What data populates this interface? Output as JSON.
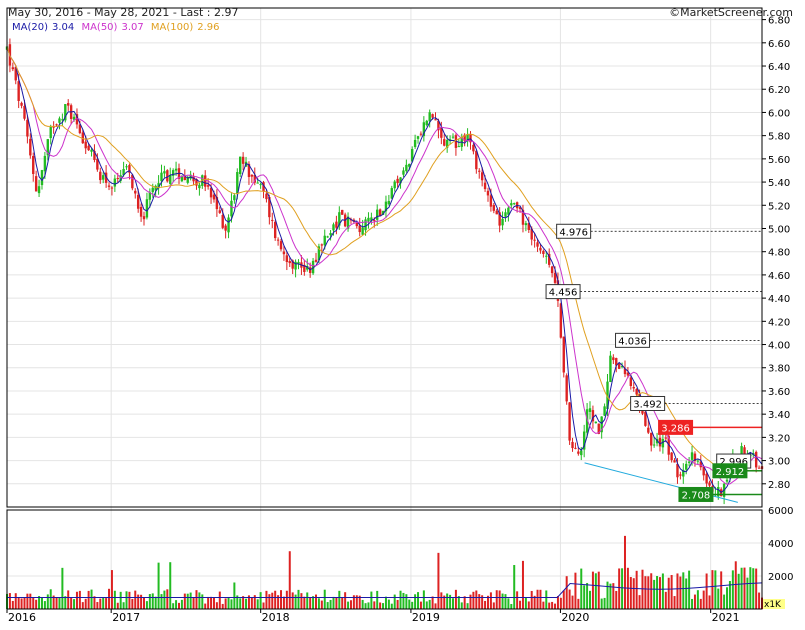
{
  "header": {
    "range_text": "May 30, 2016 - May 28, 2021 - Last : 2.97",
    "brand": "©MarketScreener.com"
  },
  "legend": [
    {
      "label": "MA(20)",
      "value": "3.04",
      "color": "#1a1aa6"
    },
    {
      "label": "MA(50)",
      "value": "3.07",
      "color": "#cc33cc"
    },
    {
      "label": "MA(100)",
      "value": "2.96",
      "color": "#e0a020"
    }
  ],
  "colors": {
    "up": "#22bb22",
    "down": "#dd2222",
    "grid": "#e4e4e4",
    "frame": "#000000",
    "trend": "#22aadd",
    "label_red": "#ee2222",
    "label_green": "#1a8a1a"
  },
  "chart_data": {
    "type": "candlestick",
    "title": "",
    "x_ticks": [
      "2016",
      "2017",
      "2018",
      "2019",
      "2020",
      "2021"
    ],
    "price_axis": {
      "ylim": [
        2.6,
        6.9
      ],
      "ticks": [
        "6.80",
        "6.60",
        "6.40",
        "6.20",
        "6.00",
        "5.80",
        "5.60",
        "5.40",
        "5.20",
        "5.00",
        "4.80",
        "4.60",
        "4.40",
        "4.20",
        "4.00",
        "3.80",
        "3.60",
        "3.40",
        "3.20",
        "3.00",
        "2.80"
      ]
    },
    "volume_axis": {
      "ylim": [
        0,
        6000
      ],
      "ticks": [
        "6000",
        "4000",
        "2000"
      ],
      "unit": "x1K"
    },
    "close_path": [
      {
        "t": 0.0,
        "v": 6.55
      },
      {
        "t": 0.02,
        "v": 6.0
      },
      {
        "t": 0.04,
        "v": 5.3
      },
      {
        "t": 0.06,
        "v": 5.9
      },
      {
        "t": 0.08,
        "v": 6.05
      },
      {
        "t": 0.1,
        "v": 5.8
      },
      {
        "t": 0.12,
        "v": 5.5
      },
      {
        "t": 0.14,
        "v": 5.35
      },
      {
        "t": 0.16,
        "v": 5.5
      },
      {
        "t": 0.18,
        "v": 5.1
      },
      {
        "t": 0.2,
        "v": 5.45
      },
      {
        "t": 0.23,
        "v": 5.48
      },
      {
        "t": 0.26,
        "v": 5.4
      },
      {
        "t": 0.29,
        "v": 5.0
      },
      {
        "t": 0.31,
        "v": 5.6
      },
      {
        "t": 0.34,
        "v": 5.3
      },
      {
        "t": 0.36,
        "v": 4.85
      },
      {
        "t": 0.38,
        "v": 4.7
      },
      {
        "t": 0.4,
        "v": 4.65
      },
      {
        "t": 0.42,
        "v": 4.9
      },
      {
        "t": 0.44,
        "v": 5.1
      },
      {
        "t": 0.47,
        "v": 5.0
      },
      {
        "t": 0.5,
        "v": 5.2
      },
      {
        "t": 0.53,
        "v": 5.55
      },
      {
        "t": 0.56,
        "v": 6.0
      },
      {
        "t": 0.58,
        "v": 5.7
      },
      {
        "t": 0.61,
        "v": 5.8
      },
      {
        "t": 0.63,
        "v": 5.4
      },
      {
        "t": 0.65,
        "v": 5.05
      },
      {
        "t": 0.67,
        "v": 5.3
      },
      {
        "t": 0.69,
        "v": 4.95
      },
      {
        "t": 0.71,
        "v": 4.8
      },
      {
        "t": 0.73,
        "v": 4.4
      },
      {
        "t": 0.745,
        "v": 3.2
      },
      {
        "t": 0.76,
        "v": 3.0
      },
      {
        "t": 0.77,
        "v": 3.5
      },
      {
        "t": 0.785,
        "v": 3.2
      },
      {
        "t": 0.8,
        "v": 3.95
      },
      {
        "t": 0.82,
        "v": 3.7
      },
      {
        "t": 0.84,
        "v": 3.5
      },
      {
        "t": 0.855,
        "v": 3.1
      },
      {
        "t": 0.87,
        "v": 3.2
      },
      {
        "t": 0.89,
        "v": 2.85
      },
      {
        "t": 0.91,
        "v": 3.05
      },
      {
        "t": 0.93,
        "v": 2.8
      },
      {
        "t": 0.945,
        "v": 2.72
      },
      {
        "t": 0.96,
        "v": 3.0
      },
      {
        "t": 0.975,
        "v": 3.1
      },
      {
        "t": 0.99,
        "v": 3.0
      },
      {
        "t": 1.0,
        "v": 2.97
      }
    ],
    "levels": [
      {
        "label": "4.976",
        "value": 4.976,
        "style": "white",
        "label_t": 0.728
      },
      {
        "label": "4.456",
        "value": 4.456,
        "style": "white",
        "label_t": 0.714
      },
      {
        "label": "4.036",
        "value": 4.036,
        "style": "white",
        "label_t": 0.806
      },
      {
        "label": "3.492",
        "value": 3.492,
        "style": "white",
        "label_t": 0.826
      },
      {
        "label": "3.286",
        "value": 3.286,
        "style": "red",
        "label_t": 0.863
      },
      {
        "label": "2.996",
        "value": 2.996,
        "style": "white",
        "label_t": 0.94
      },
      {
        "label": "2.912",
        "value": 2.912,
        "style": "green",
        "label_t": 0.935
      },
      {
        "label": "2.708",
        "value": 2.708,
        "style": "green",
        "label_t": 0.89
      }
    ],
    "trendline": [
      {
        "t": 0.765,
        "v": 2.98
      },
      {
        "t": 0.968,
        "v": 2.64
      }
    ]
  }
}
